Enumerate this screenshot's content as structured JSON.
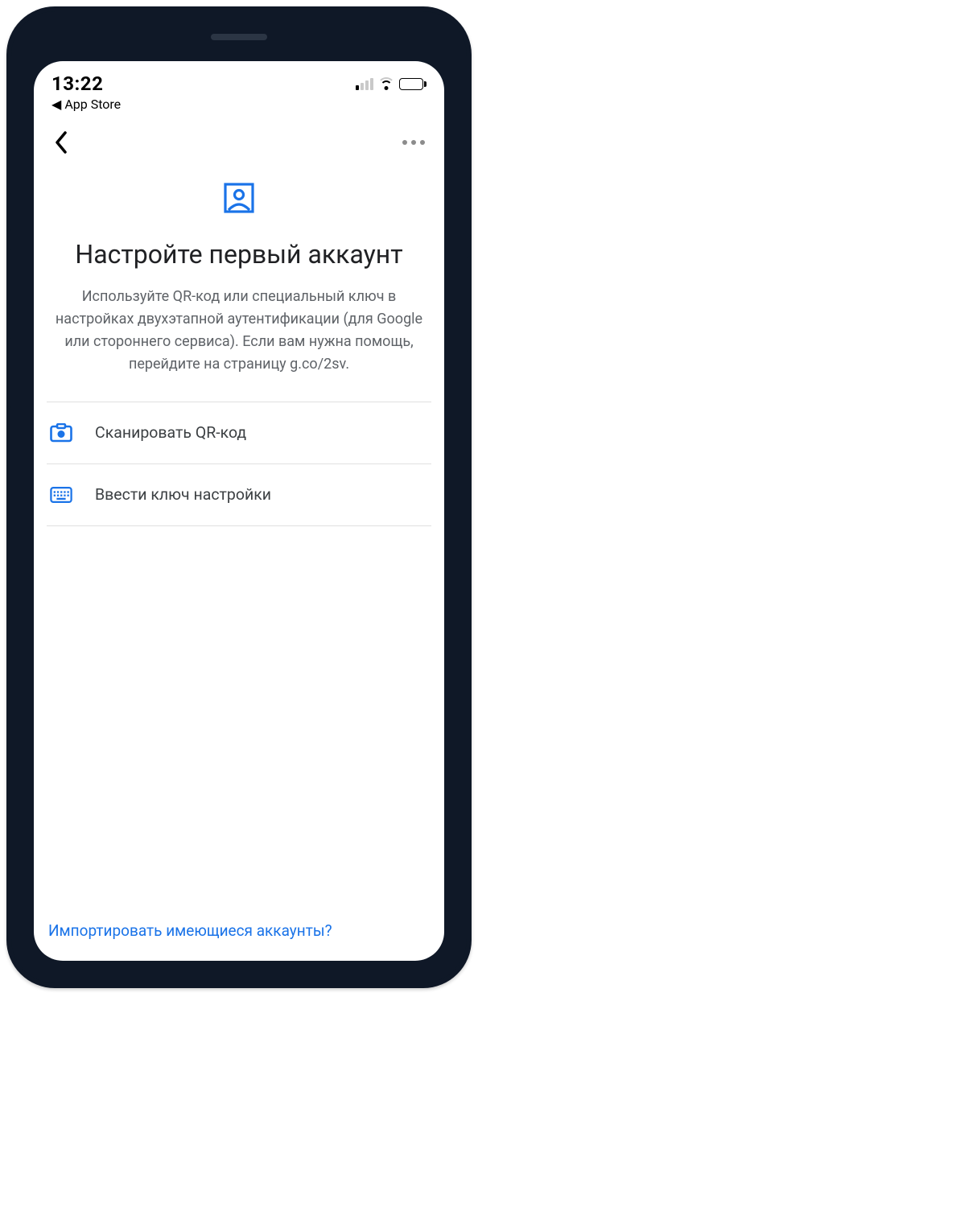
{
  "status": {
    "time": "13:22",
    "back_to_app_label": "App Store"
  },
  "content": {
    "title": "Настройте первый аккаунт",
    "subtitle": "Используйте QR-код или специальный ключ в настройках двухэтапной аутентификации (для Google или стороннего сервиса). Если вам нужна помощь, перейдите на страницу g.co/2sv."
  },
  "options": {
    "scan_label": "Сканировать QR-код",
    "key_label": "Ввести ключ настройки"
  },
  "footer": {
    "import_label": "Импортировать имеющиеся аккаунты?"
  },
  "colors": {
    "accent": "#1a73e8"
  }
}
